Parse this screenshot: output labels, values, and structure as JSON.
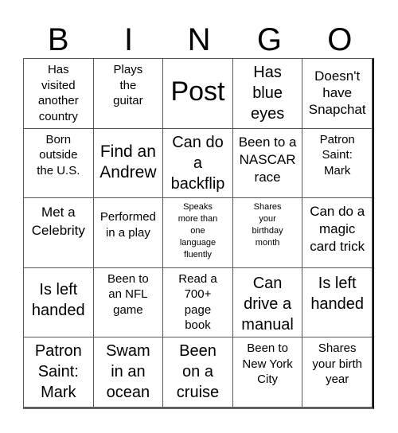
{
  "header": [
    "B",
    "I",
    "N",
    "G",
    "O"
  ],
  "cells": [
    [
      "Has visited another country",
      "Plays the guitar",
      "Post",
      "Has blue eyes",
      "Doesn't have Snapchat"
    ],
    [
      "Born outside the U.S.",
      "Find an Andrew",
      "Can do a backflip",
      "Been to a NASCAR race",
      "Patron Saint: Mark"
    ],
    [
      "Met a Celebrity",
      "Performed in a play",
      "Speaks more than one language fluently",
      "Shares your birthday month",
      "Can do a magic card trick"
    ],
    [
      "Is left handed",
      "Been to an NFL game",
      "Read a 700+ page book",
      "Can drive a manual",
      "Is left handed"
    ],
    [
      "Patron Saint: Mark",
      "Swam in an ocean",
      "Been on a cruise",
      "Been to New York City",
      "Shares your birth year"
    ]
  ]
}
